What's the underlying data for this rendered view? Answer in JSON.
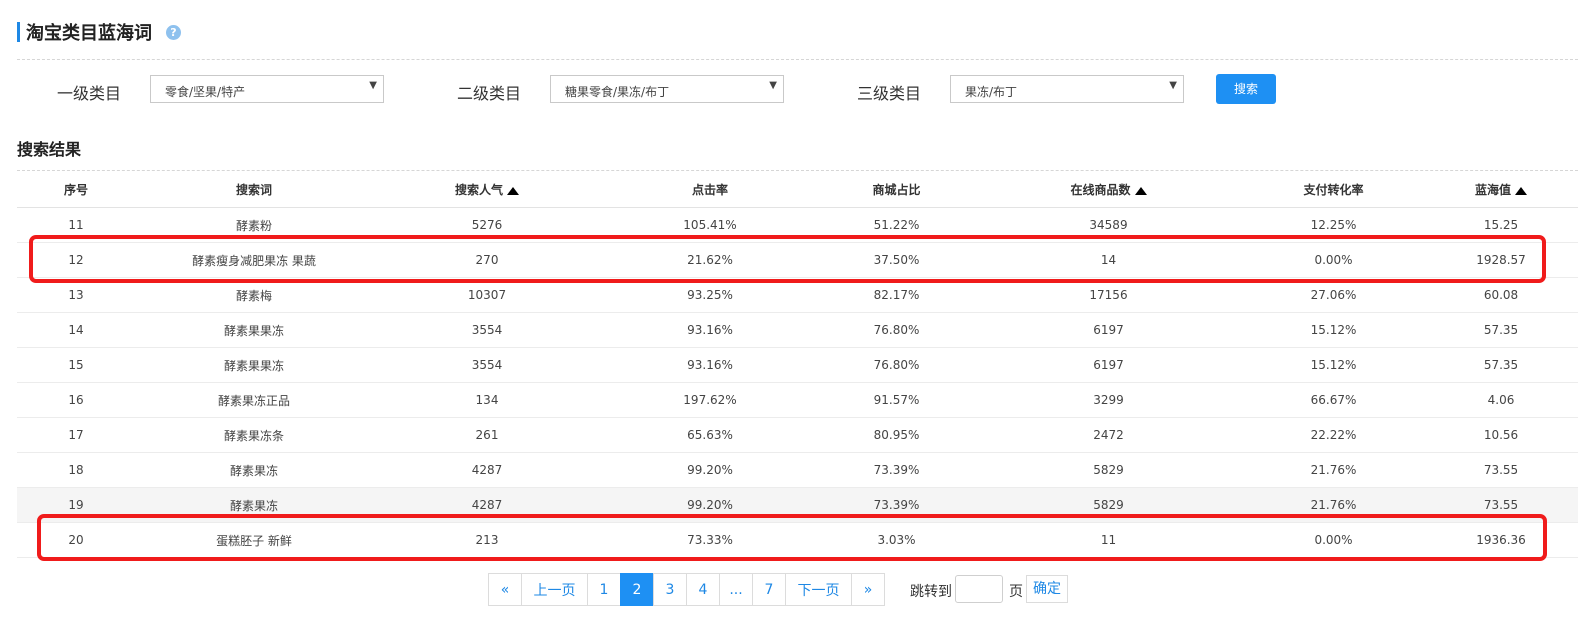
{
  "page": {
    "title": "淘宝类目蓝海词",
    "help_icon": "?"
  },
  "filters": {
    "level1": {
      "label": "一级类目",
      "value": "零食/坚果/特产"
    },
    "level2": {
      "label": "二级类目",
      "value": "糖果零食/果冻/布丁"
    },
    "level3": {
      "label": "三级类目",
      "value": "果冻/布丁"
    },
    "search_button": "搜索",
    "dropdown_arrow": "▼"
  },
  "results": {
    "title": "搜索结果",
    "columns": [
      "序号",
      "搜索词",
      "搜索人气",
      "点击率",
      "商城占比",
      "在线商品数",
      "支付转化率",
      "蓝海值"
    ],
    "sortable_columns": [
      "搜索人气",
      "在线商品数",
      "蓝海值"
    ],
    "rows": [
      [
        "11",
        "酵素粉",
        "5276",
        "105.41%",
        "51.22%",
        "34589",
        "12.25%",
        "15.25"
      ],
      [
        "12",
        "酵素瘦身减肥果冻 果蔬",
        "270",
        "21.62%",
        "37.50%",
        "14",
        "0.00%",
        "1928.57"
      ],
      [
        "13",
        "酵素梅",
        "10307",
        "93.25%",
        "82.17%",
        "17156",
        "27.06%",
        "60.08"
      ],
      [
        "14",
        "酵素果果冻",
        "3554",
        "93.16%",
        "76.80%",
        "6197",
        "15.12%",
        "57.35"
      ],
      [
        "15",
        "酵素果果冻",
        "3554",
        "93.16%",
        "76.80%",
        "6197",
        "15.12%",
        "57.35"
      ],
      [
        "16",
        "酵素果冻正品",
        "134",
        "197.62%",
        "91.57%",
        "3299",
        "66.67%",
        "4.06"
      ],
      [
        "17",
        "酵素果冻条",
        "261",
        "65.63%",
        "80.95%",
        "2472",
        "22.22%",
        "10.56"
      ],
      [
        "18",
        "酵素果冻",
        "4287",
        "99.20%",
        "73.39%",
        "5829",
        "21.76%",
        "73.55"
      ],
      [
        "19",
        "酵素果冻",
        "4287",
        "99.20%",
        "73.39%",
        "5829",
        "21.76%",
        "73.55"
      ],
      [
        "20",
        "蛋糕胚子 新鲜",
        "213",
        "73.33%",
        "3.03%",
        "11",
        "0.00%",
        "1936.36"
      ]
    ],
    "highlighted_rows": [
      "12",
      "20"
    ],
    "hover_row": "19"
  },
  "pagination": {
    "first": "«",
    "prev": "上一页",
    "pages": [
      "1",
      "2",
      "3",
      "4",
      "...",
      "7"
    ],
    "current": "2",
    "next": "下一页",
    "last": "»",
    "jump_label": "跳转到",
    "page_unit": "页",
    "confirm": "确定"
  },
  "colors": {
    "accent": "#1e90f3",
    "highlight": "#f01b1b"
  }
}
